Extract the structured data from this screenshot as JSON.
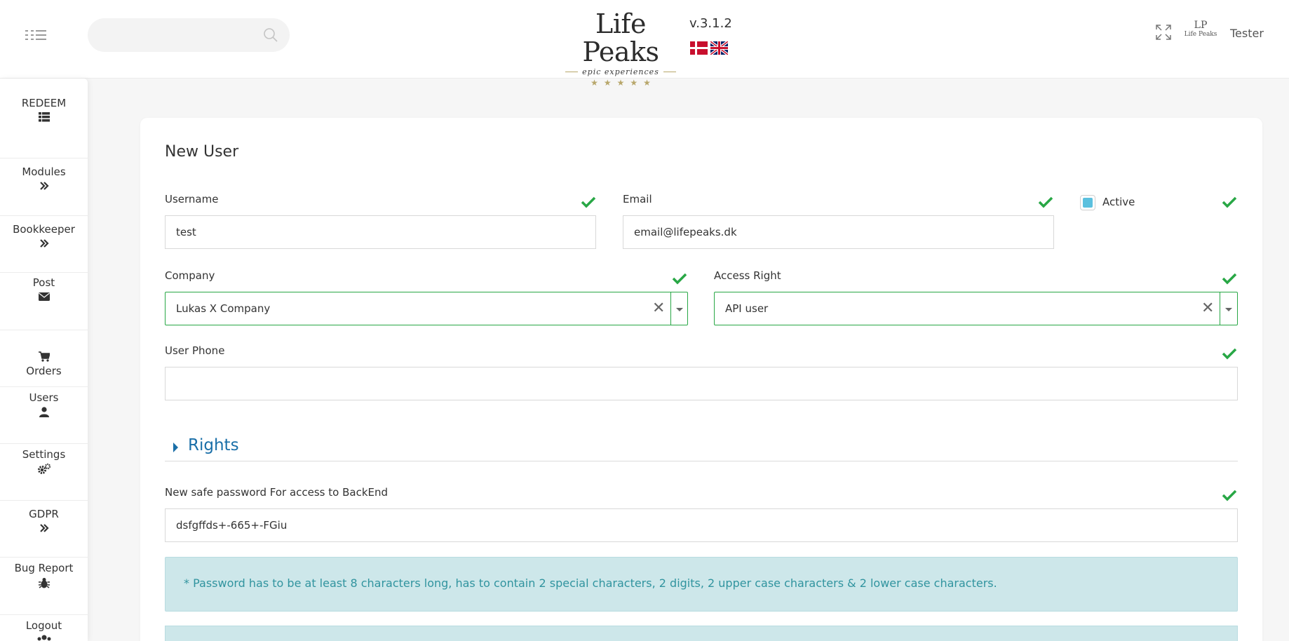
{
  "header": {
    "search_placeholder": "",
    "logo_title": "Life Peaks",
    "logo_subtitle": "epic experiences",
    "logo_stars": "★★★★★",
    "version": "v.3.1.2",
    "avatar_monogram": "LP",
    "avatar_name": "Life Peaks",
    "user_name": "Tester"
  },
  "sidebar": {
    "items": [
      {
        "label": "REDEEM",
        "icon": "list-icon"
      },
      {
        "label": "Modules",
        "icon": "chevrons-right-icon"
      },
      {
        "label": "Bookkeeper",
        "icon": "chevrons-right-icon"
      },
      {
        "label": "Post",
        "icon": "envelope-icon"
      },
      {
        "label": "Orders",
        "icon": "cart-icon"
      },
      {
        "label": "Users",
        "icon": "user-icon"
      },
      {
        "label": "Settings",
        "icon": "cogs-icon"
      },
      {
        "label": "GDPR",
        "icon": "chevrons-right-icon"
      },
      {
        "label": "Bug Report",
        "icon": "bug-icon"
      },
      {
        "label": "Logout",
        "icon": "users-icon"
      }
    ]
  },
  "form": {
    "title": "New User",
    "username_label": "Username",
    "username_value": "test",
    "email_label": "Email",
    "email_value": "email@lifepeaks.dk",
    "active_label": "Active",
    "company_label": "Company",
    "company_value": "Lukas X Company",
    "access_label": "Access Right",
    "access_value": "API user",
    "phone_label": "User Phone",
    "phone_value": "",
    "rights_label": "Rights",
    "password_label": "New safe password For access to BackEnd",
    "password_value": "dsfgffds+-665+-FGiu",
    "password_hint": "* Password has to be at least 8 characters long, has to contain 2 special characters, 2 digits, 2 upper case characters & 2 lower case characters.",
    "clear_symbol": "✕"
  },
  "colors": {
    "valid": "#28a745",
    "link": "#1a6fa8",
    "info_bg": "#cde7ea",
    "info_text": "#31949f",
    "checkbox": "#5bc0de"
  }
}
